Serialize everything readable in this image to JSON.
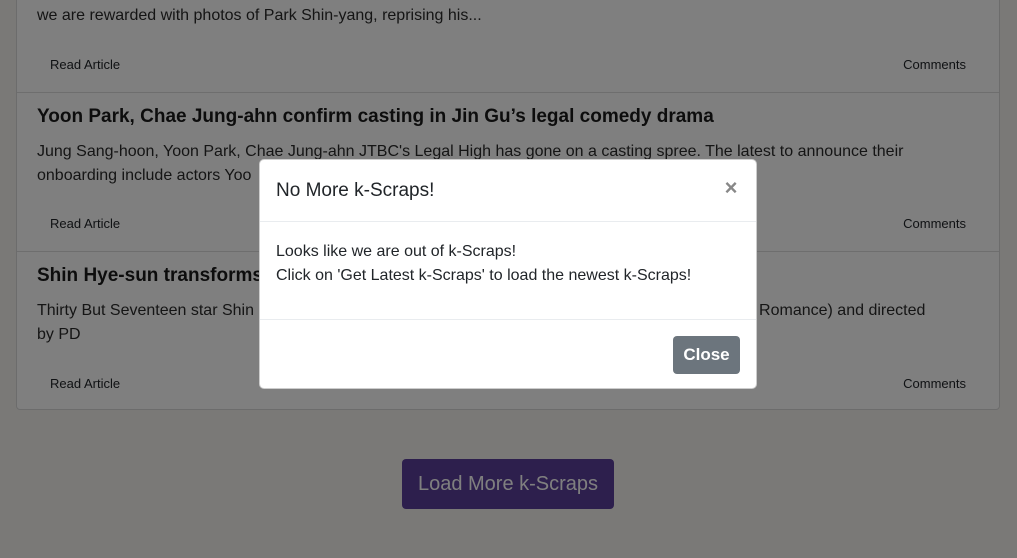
{
  "articles": [
    {
      "title": "",
      "summary": "we are rewarded with photos of Park Shin-yang, reprising his...",
      "read_label": "Read Article",
      "comments_label": "Comments"
    },
    {
      "title": "Yoon Park, Chae Jung-ahn confirm casting in Jin Gu’s legal comedy drama",
      "summary": "Jung Sang-hoon, Yoon Park, Chae Jung-ahn JTBC's Legal High has gone on a casting spree. The latest to announce their onboarding include actors Yoo",
      "read_label": "Read Article",
      "comments_label": "Comments"
    },
    {
      "title": "Shin Hye-sun transforms i",
      "summary": "Thirty But Seventeen star Shin                                                                         by Choi Yoon-kyo (Lucky Romance) and directed by PD",
      "read_label": "Read Article",
      "comments_label": "Comments"
    }
  ],
  "load_more_label": "Load More k-Scraps",
  "modal": {
    "title": "No More k-Scraps!",
    "close_icon": "×",
    "body_line1": "Looks like we are out of k-Scraps!",
    "body_line2": "Click on 'Get Latest k-Scraps' to load the newest k-Scraps!",
    "close_label": "Close"
  },
  "colors": {
    "accent": "#5a3f9a",
    "secondary": "#6c757d"
  }
}
